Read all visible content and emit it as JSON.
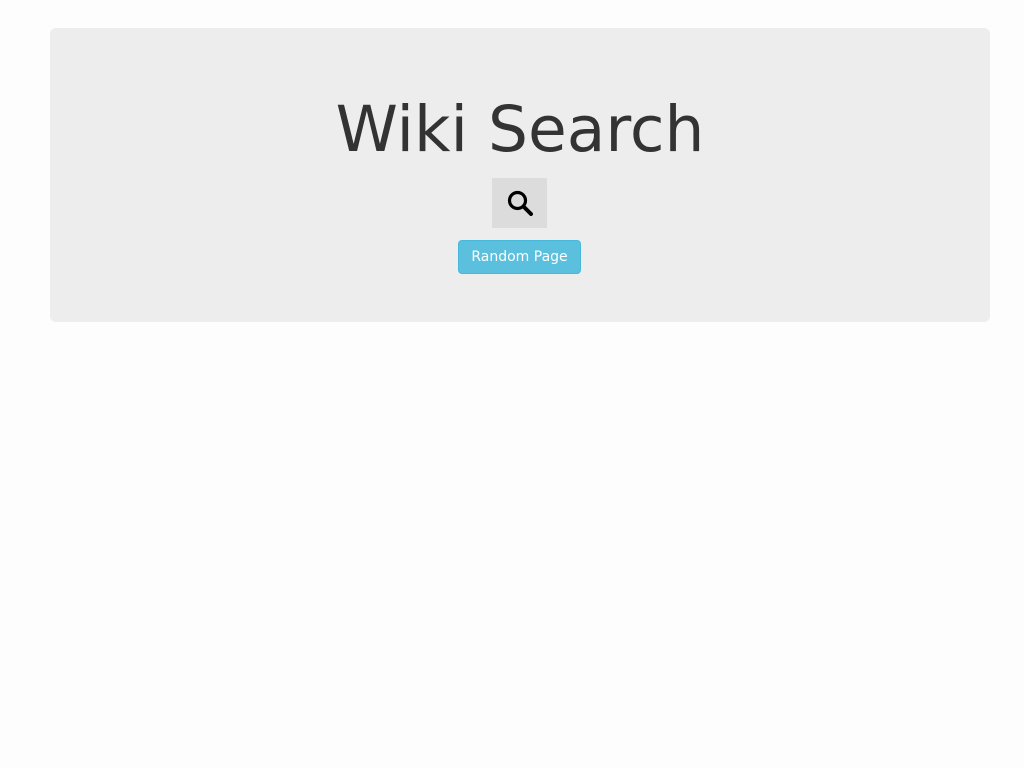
{
  "header": {
    "title": "Wiki Search"
  },
  "search": {
    "icon": "search-icon"
  },
  "random": {
    "label": "Random Page",
    "color": "#5bc0de"
  },
  "colors": {
    "panel_background": "#ededed",
    "search_button_background": "#dcdcdc",
    "title_text": "#333333"
  }
}
